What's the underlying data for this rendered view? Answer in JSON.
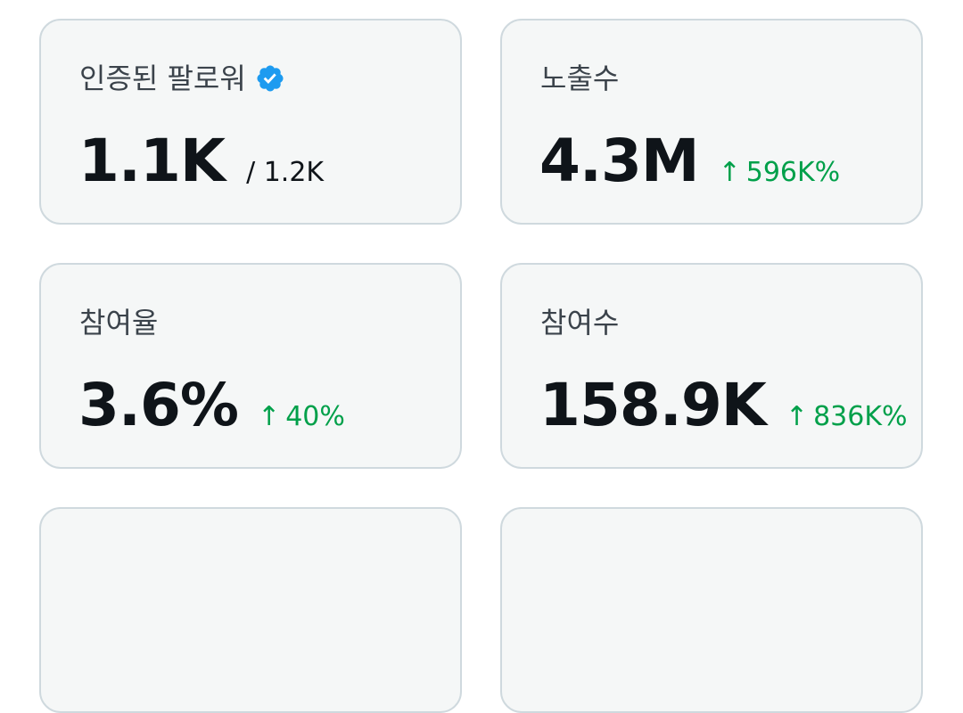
{
  "colors": {
    "card_background": "#f5f7f7",
    "card_border": "#cfd9de",
    "label": "#3b434b",
    "value": "#0f1419",
    "positive_delta": "#00a04a",
    "verified_badge": "#1d9bf0"
  },
  "cards": [
    {
      "label": "인증된 팔로워",
      "icon": "verified-badge-icon",
      "value": "1.1K",
      "total": "/ 1.2K"
    },
    {
      "label": "노출수",
      "value": "4.3M",
      "delta_icon": "arrow-up-icon",
      "delta_arrow": "↑",
      "delta": "596K%"
    },
    {
      "label": "참여율",
      "value": "3.6%",
      "delta_icon": "arrow-up-icon",
      "delta_arrow": "↑",
      "delta": "40%"
    },
    {
      "label": "참여수",
      "value": "158.9K",
      "delta_icon": "arrow-up-icon",
      "delta_arrow": "↑",
      "delta": "836K%"
    }
  ]
}
